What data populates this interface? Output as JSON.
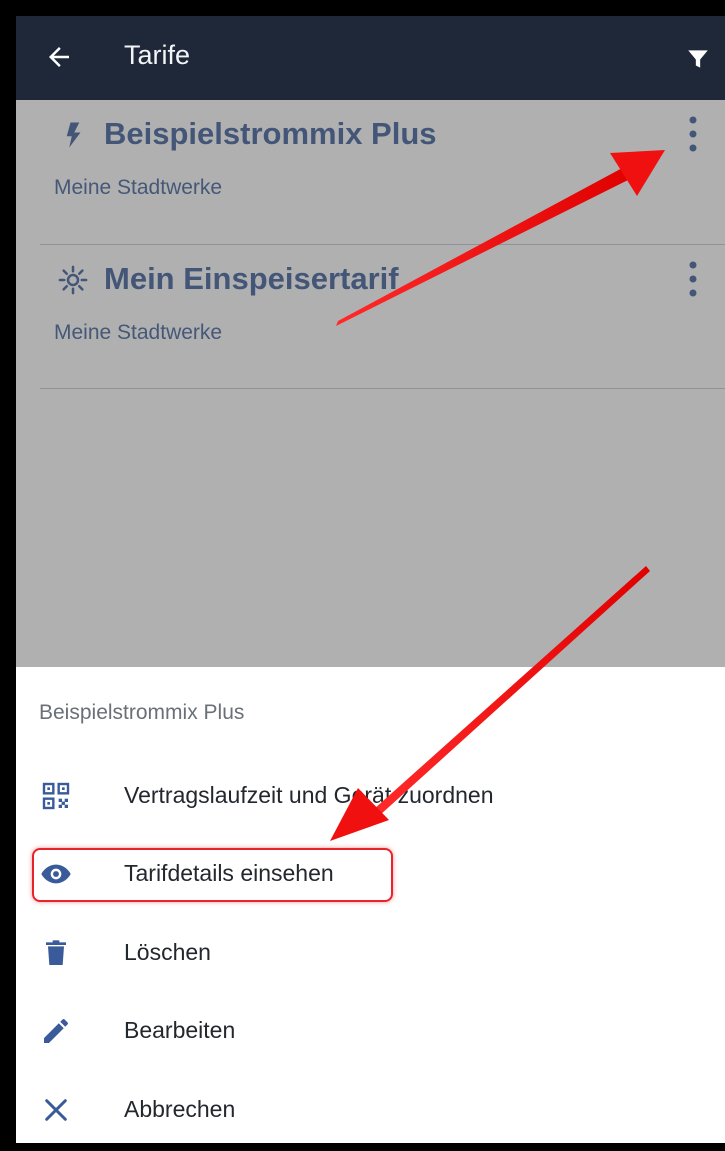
{
  "appbar": {
    "title": "Tarife",
    "back_icon": "arrow-left-icon",
    "filter_icon": "filter-icon",
    "background": "#1e2839"
  },
  "tariffs": [
    {
      "name": "Beispielstrommix Plus",
      "provider": "Meine Stadtwerke",
      "icon": "lightning-bolt-icon"
    },
    {
      "name": "Mein Einspeisertarif",
      "provider": "Meine Stadtwerke",
      "icon": "sun-icon"
    }
  ],
  "sheet": {
    "title": "Beispielstrommix Plus",
    "items": [
      {
        "label": "Vertragslaufzeit und Gerät zuordnen",
        "icon": "qr-code-icon"
      },
      {
        "label": "Tarifdetails einsehen",
        "icon": "eye-icon",
        "highlighted": true
      },
      {
        "label": "Löschen",
        "icon": "trash-icon"
      },
      {
        "label": "Bearbeiten",
        "icon": "pencil-icon"
      },
      {
        "label": "Abbrechen",
        "icon": "close-icon"
      }
    ]
  },
  "colors": {
    "accent": "#3a5b9a",
    "annotation_red": "#e8232a"
  }
}
